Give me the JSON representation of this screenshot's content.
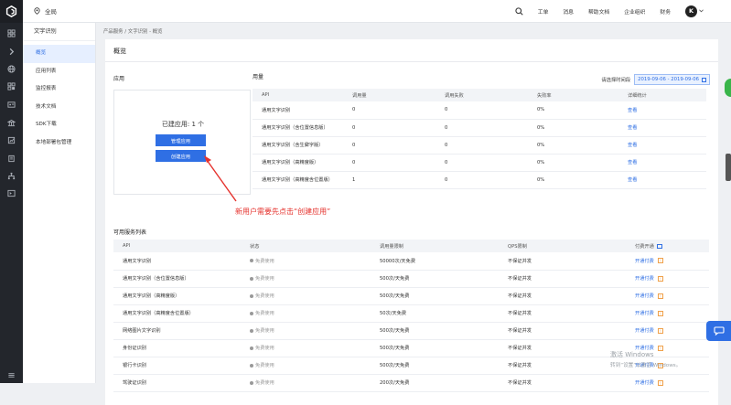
{
  "topbar": {
    "region": "全局",
    "menu": [
      "工单",
      "消息",
      "帮助文档",
      "企业组织",
      "财务"
    ],
    "avatar_letter": "K"
  },
  "rail_icons": [
    "grid-icon",
    "chevron-right-icon",
    "globe-icon",
    "grid-icon",
    "id-card-icon",
    "bank-icon",
    "report-icon",
    "book-icon",
    "hierarchy-icon",
    "terminal-icon"
  ],
  "subnav": {
    "title": "文字识别",
    "items": [
      "概览",
      "应用列表",
      "监控报表",
      "技术文档",
      "SDK下载",
      "本地部署包管理"
    ]
  },
  "breadcrumb": "产品服务 / 文字识别 - 概览",
  "page_title": "概览",
  "apps": {
    "section_title": "应用",
    "count_text": "已建应用: 1 个",
    "manage_label": "管理应用",
    "create_label": "创建应用"
  },
  "usage": {
    "section_title": "用量",
    "date_label": "请选择时间段",
    "date_range": "2019-09-06 - 2019-09-06",
    "headers": [
      "API",
      "调用量",
      "调用失败",
      "失败率",
      "详细统计"
    ],
    "rows": [
      [
        "通用文字识别",
        "0",
        "0",
        "0%",
        "查看"
      ],
      [
        "通用文字识别（含位置信息版）",
        "0",
        "0",
        "0%",
        "查看"
      ],
      [
        "通用文字识别（含生僻字版）",
        "0",
        "0",
        "0%",
        "查看"
      ],
      [
        "通用文字识别（高精度版）",
        "0",
        "0",
        "0%",
        "查看"
      ],
      [
        "通用文字识别（高精度含位置版）",
        "1",
        "0",
        "0%",
        "查看"
      ]
    ]
  },
  "services": {
    "section_title": "可用服务列表",
    "headers": [
      "API",
      "状态",
      "调用量限制",
      "QPS限制",
      "付费开通"
    ],
    "rows": [
      [
        "通用文字识别",
        "免费使用",
        "50000次/天免费",
        "不保证并发",
        "开通付费"
      ],
      [
        "通用文字识别（含位置信息版）",
        "免费使用",
        "500次/天免费",
        "不保证并发",
        "开通付费"
      ],
      [
        "通用文字识别（高精度版）",
        "免费使用",
        "500次/天免费",
        "不保证并发",
        "开通付费"
      ],
      [
        "通用文字识别（高精度含位置版）",
        "免费使用",
        "50次/天免费",
        "不保证并发",
        "开通付费"
      ],
      [
        "网络图片文字识别",
        "免费使用",
        "500次/天免费",
        "不保证并发",
        "开通付费"
      ],
      [
        "身份证识别",
        "免费使用",
        "500次/天免费",
        "不保证并发",
        "开通付费"
      ],
      [
        "银行卡识别",
        "免费使用",
        "500次/天免费",
        "不保证并发",
        "开通付费"
      ],
      [
        "驾驶证识别",
        "免费使用",
        "200次/天免费",
        "不保证并发",
        "开通付费"
      ]
    ]
  },
  "annotation": "新用户需要先点击“创建应用”",
  "watermark": {
    "line1": "激活 Windows",
    "line2": "转到“设置”以激活 Windows。"
  },
  "colors": {
    "accent": "#2f6fe4",
    "annotation": "#e5322d",
    "sidebar_dark": "#23262c"
  }
}
